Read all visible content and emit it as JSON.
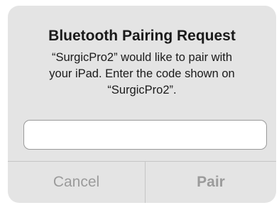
{
  "dialog": {
    "title": "Bluetooth Pairing Request",
    "message_lines": [
      "“SurgicPro2” would like to pair with",
      "your iPad. Enter the code shown on",
      "“SurgicPro2”."
    ],
    "code_input": {
      "value": "",
      "placeholder": ""
    },
    "buttons": {
      "cancel_label": "Cancel",
      "pair_label": "Pair"
    }
  },
  "colors": {
    "dialog_background": "#e4e4e4",
    "button_text_disabled": "#9b9b9b",
    "divider": "#c6c6c6"
  }
}
